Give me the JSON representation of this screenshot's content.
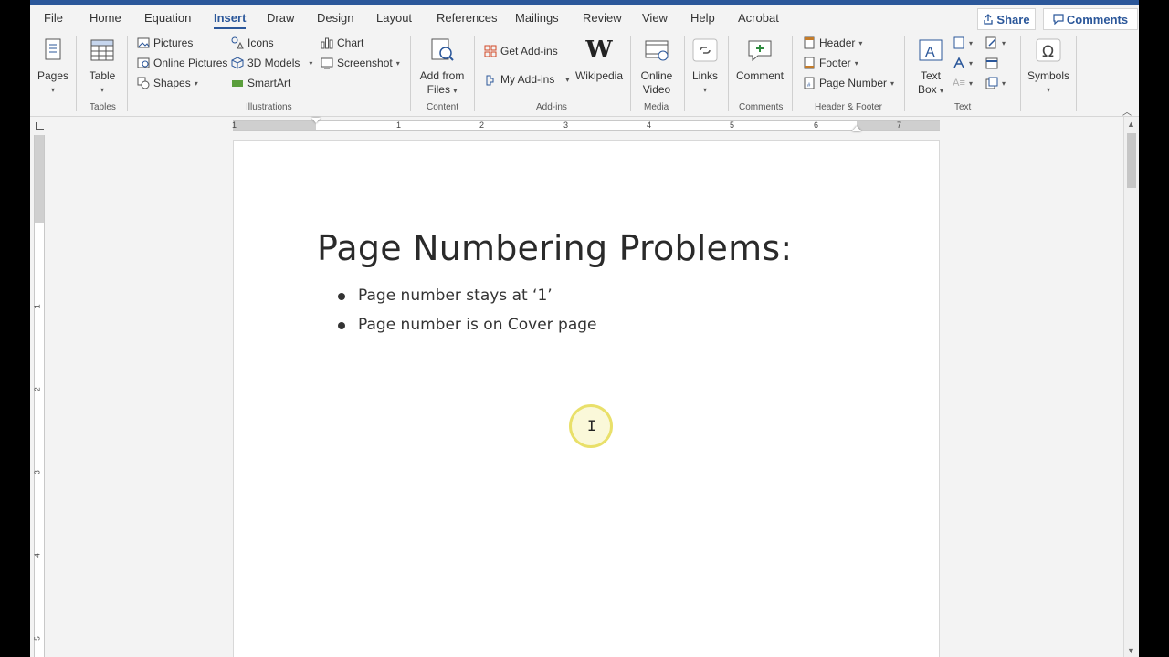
{
  "tabs": [
    "File",
    "Home",
    "Equation",
    "Insert",
    "Draw",
    "Design",
    "Layout",
    "References",
    "Mailings",
    "Review",
    "View",
    "Help",
    "Acrobat"
  ],
  "active_tab": "Insert",
  "share_label": "Share",
  "comments_label": "Comments",
  "ribbon": {
    "pages": "Pages",
    "table": "Table",
    "tables_group": "Tables",
    "pictures": "Pictures",
    "online_pictures": "Online Pictures",
    "shapes": "Shapes",
    "icons": "Icons",
    "models_3d": "3D Models",
    "smartart": "SmartArt",
    "chart": "Chart",
    "screenshot": "Screenshot",
    "illustrations_group": "Illustrations",
    "add_from": "Add from",
    "files": "Files",
    "content_group": "Content",
    "get_addins": "Get Add-ins",
    "my_addins": "My Add-ins",
    "wikipedia": "Wikipedia",
    "addins_group": "Add-ins",
    "online": "Online",
    "video": "Video",
    "media_group": "Media",
    "links": "Links",
    "comment": "Comment",
    "comments_group": "Comments",
    "header": "Header",
    "footer": "Footer",
    "page_number": "Page Number",
    "header_footer_group": "Header & Footer",
    "text_label": "Text",
    "box_label": "Box",
    "text_group": "Text",
    "symbols": "Symbols"
  },
  "ruler_numbers": [
    "1",
    "1",
    "2",
    "3",
    "4",
    "5",
    "6",
    "7"
  ],
  "vruler_numbers": [
    "1",
    "2",
    "3",
    "4",
    "5"
  ],
  "document": {
    "title": "Page Numbering Problems:",
    "bullets": [
      "Page number stays at ‘1’",
      "Page number is on Cover page"
    ]
  },
  "colors": {
    "accent": "#2b579a"
  }
}
